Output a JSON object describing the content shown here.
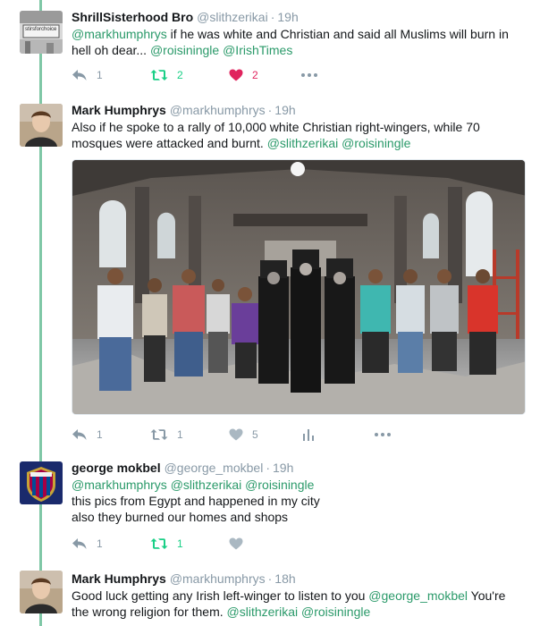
{
  "tweets": [
    {
      "name": "ShrillSisterhood Bro",
      "handle": "@slithzerikai",
      "dot": "·",
      "time": "19h",
      "text_parts": [
        {
          "t": "@markhumphrys",
          "k": "m"
        },
        {
          "t": " if he was white and Christian and said all Muslims will burn in hell oh dear... ",
          "k": "p"
        },
        {
          "t": "@roisiningle",
          "k": "m"
        },
        {
          "t": " ",
          "k": "p"
        },
        {
          "t": "@IrishTimes",
          "k": "m"
        }
      ],
      "avatar_text": "stirsforchoice",
      "actions": {
        "reply": "1",
        "retweet": "2",
        "like": "2"
      }
    },
    {
      "name": "Mark Humphrys",
      "handle": "@markhumphrys",
      "dot": "·",
      "time": "19h",
      "text_parts": [
        {
          "t": "Also if he spoke to a rally of 10,000 white Christian right-wingers, while 70 mosques were attacked and burnt.  ",
          "k": "p"
        },
        {
          "t": "@slithzerikai",
          "k": "m"
        },
        {
          "t": " ",
          "k": "p"
        },
        {
          "t": "@roisiningle",
          "k": "m"
        }
      ],
      "actions": {
        "reply": "1",
        "retweet": "1",
        "like": "5"
      }
    },
    {
      "name": "george mokbel",
      "handle": "@george_mokbel",
      "dot": "·",
      "time": "19h",
      "line1": [
        {
          "t": "@markhumphrys",
          "k": "m"
        },
        {
          "t": " ",
          "k": "p"
        },
        {
          "t": "@slithzerikai",
          "k": "m"
        },
        {
          "t": " ",
          "k": "p"
        },
        {
          "t": "@roisiningle",
          "k": "m"
        }
      ],
      "line2": "this pics from Egypt and happened in my city",
      "line3": "also they burned our homes and shops",
      "actions": {
        "reply": "1",
        "retweet": "1"
      }
    },
    {
      "name": "Mark Humphrys",
      "handle": "@markhumphrys",
      "dot": "·",
      "time": "18h",
      "text_parts": [
        {
          "t": "Good luck getting any Irish left-winger to listen to you  ",
          "k": "p"
        },
        {
          "t": "@george_mokbel",
          "k": "m"
        },
        {
          "t": "  You're the wrong religion for them.  ",
          "k": "p"
        },
        {
          "t": "@slithzerikai",
          "k": "m"
        },
        {
          "t": " ",
          "k": "p"
        },
        {
          "t": "@roisiningle",
          "k": "m"
        }
      ]
    }
  ],
  "icons": {
    "reply": "reply-icon",
    "retweet": "retweet-icon",
    "like": "heart-icon",
    "analytics": "analytics-icon",
    "more": "more-icon"
  },
  "colors": {
    "thread_line": "#7fc7a6",
    "mention": "#1b95e0",
    "retweet_active": "#19cf86",
    "like_active": "#e0245e",
    "muted": "#8899a6"
  }
}
